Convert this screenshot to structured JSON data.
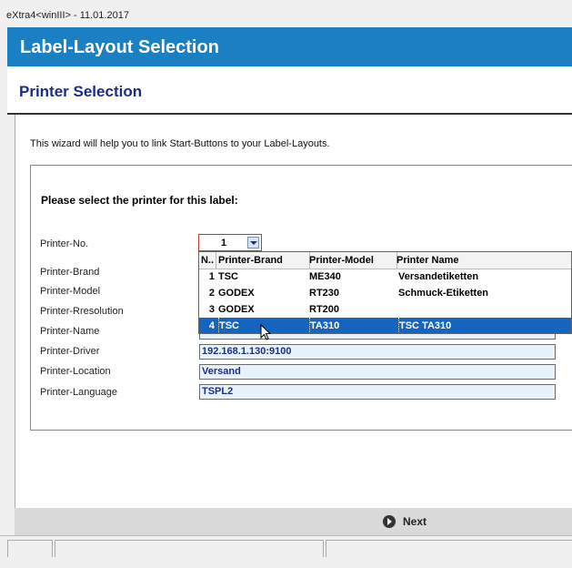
{
  "window": {
    "title": "eXtra4<winIII> - 11.01.2017"
  },
  "banner": {
    "title": "Label-Layout Selection"
  },
  "subhead": {
    "title": "Printer Selection"
  },
  "intro": "This wizard will help you to link Start-Buttons to your Label-Layouts.",
  "group": {
    "title": "Please select the printer for this label:"
  },
  "fields": {
    "printer_no_label": "Printer-No.",
    "printer_no_value": "1",
    "brand_label": "Printer-Brand",
    "model_label": "Printer-Model",
    "resolution_label": "Printer-Rresolution",
    "name_label": "Printer-Name",
    "driver_label": "Printer-Driver",
    "driver_value": "192.168.1.130:9100",
    "location_label": "Printer-Location",
    "location_value": "Versand",
    "language_label": "Printer-Language",
    "language_value": "TSPL2"
  },
  "dropdown": {
    "headers": [
      "N..",
      "Printer-Brand",
      "Printer-Model",
      "Printer Name"
    ],
    "rows": [
      {
        "no": "1",
        "brand": "TSC",
        "model": "ME340",
        "name": "Versandetiketten"
      },
      {
        "no": "2",
        "brand": "GODEX",
        "model": "RT230",
        "name": "Schmuck-Etiketten"
      },
      {
        "no": "3",
        "brand": "GODEX",
        "model": "RT200",
        "name": ""
      },
      {
        "no": "4",
        "brand": "TSC",
        "model": "TA310",
        "name": "TSC TA310"
      }
    ],
    "selected_index": 3
  },
  "buttons": {
    "next_label": "Next"
  },
  "colors": {
    "banner": "#1b7fc4",
    "heading": "#1c2d86",
    "selection": "#1565c0"
  }
}
